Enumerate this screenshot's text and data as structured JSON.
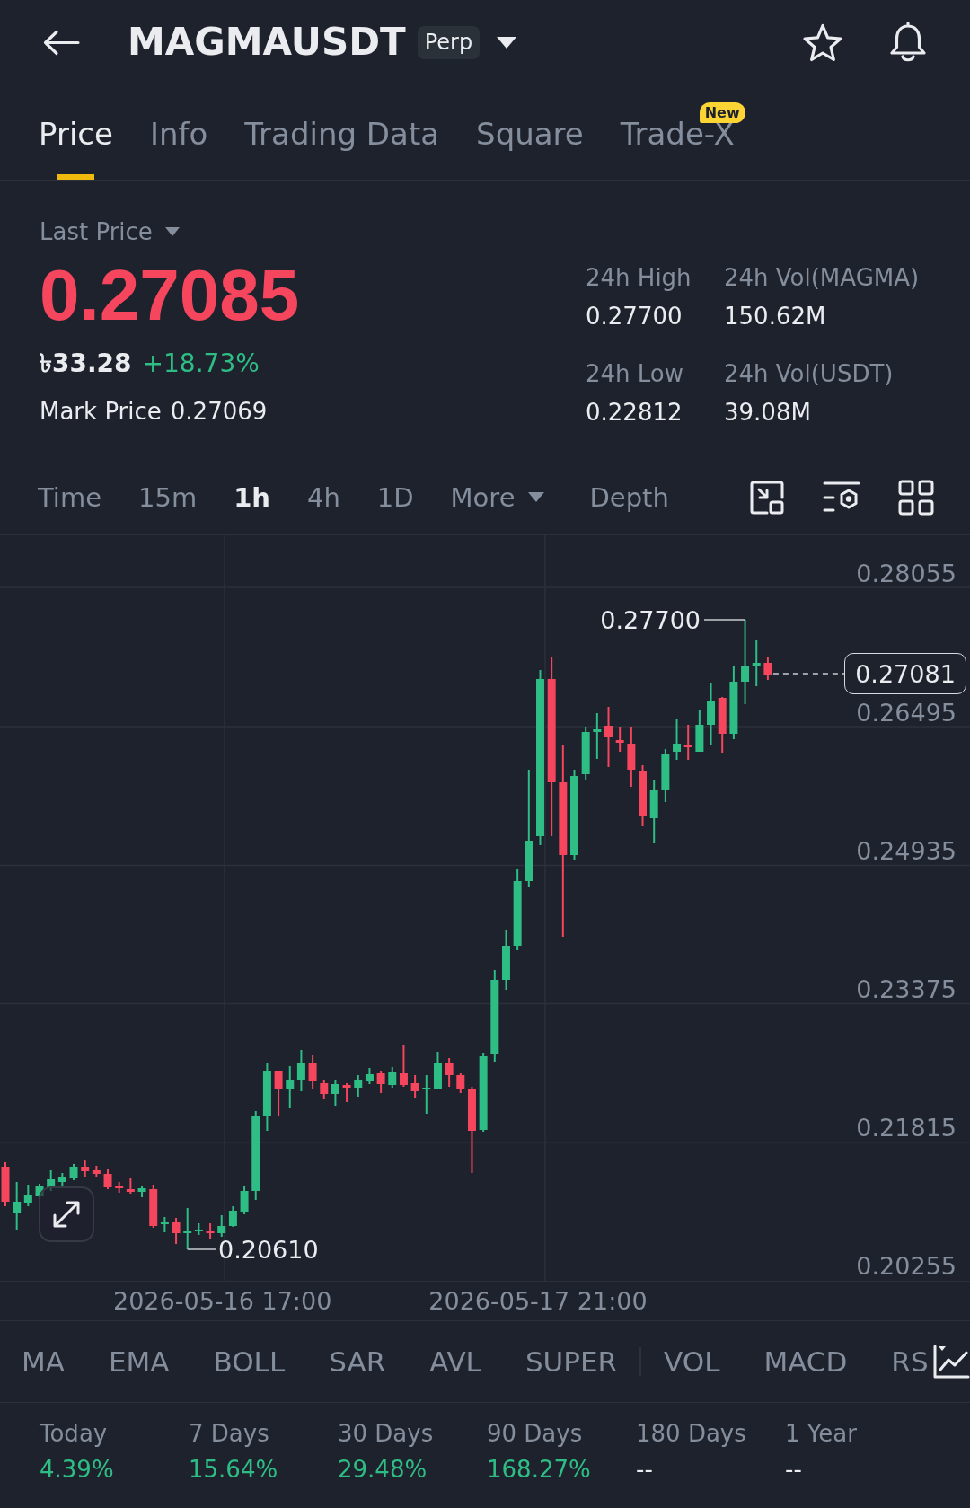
{
  "header": {
    "title": "MAGMAUSDT",
    "badge": "Perp"
  },
  "tabs": [
    {
      "label": "Price",
      "selected": true
    },
    {
      "label": "Info",
      "selected": false
    },
    {
      "label": "Trading Data",
      "selected": false
    },
    {
      "label": "Square",
      "selected": false
    },
    {
      "label": "Trade-X",
      "selected": false,
      "badge": "New"
    }
  ],
  "price": {
    "type_label": "Last Price",
    "value": "0.27085",
    "local_value": "৳33.28",
    "change": "+18.73%",
    "mark_label": "Mark Price",
    "mark_value": "0.27069"
  },
  "stats": [
    {
      "label": "24h High",
      "value": "0.27700"
    },
    {
      "label": "24h Vol(MAGMA)",
      "value": "150.62M"
    },
    {
      "label": "24h Low",
      "value": "0.22812"
    },
    {
      "label": "24h Vol(USDT)",
      "value": "39.08M"
    }
  ],
  "chart_tabs": [
    {
      "label": "Time",
      "kind": "interval",
      "selected": false
    },
    {
      "label": "15m",
      "kind": "interval",
      "selected": false
    },
    {
      "label": "1h",
      "kind": "interval",
      "selected": true
    },
    {
      "label": "4h",
      "kind": "interval",
      "selected": false
    },
    {
      "label": "1D",
      "kind": "interval",
      "selected": false
    },
    {
      "label": "More",
      "kind": "dropdown",
      "selected": false
    },
    {
      "label": "Depth",
      "kind": "view",
      "selected": false
    }
  ],
  "chart": {
    "price_labels": [
      "0.28055",
      "0.26495",
      "0.24935",
      "0.23375",
      "0.21815",
      "0.20255"
    ],
    "time_labels": [
      "2026-05-16 17:00",
      "2026-05-17 21:00"
    ],
    "high_label": "0.27700",
    "low_label": "0.20610",
    "last_price_tag": "0.27081"
  },
  "indicators": {
    "main": [
      "MA",
      "EMA",
      "BOLL",
      "SAR",
      "AVL",
      "SUPER"
    ],
    "sub": [
      "VOL",
      "MACD",
      "RS"
    ]
  },
  "returns": [
    {
      "period": "Today",
      "value": "4.39%",
      "kind": "gain"
    },
    {
      "period": "7 Days",
      "value": "15.64%",
      "kind": "gain"
    },
    {
      "period": "30 Days",
      "value": "29.48%",
      "kind": "gain"
    },
    {
      "period": "90 Days",
      "value": "168.27%",
      "kind": "gain"
    },
    {
      "period": "180 Days",
      "value": "--",
      "kind": "empty"
    },
    {
      "period": "1 Year",
      "value": "--",
      "kind": "empty"
    }
  ]
}
